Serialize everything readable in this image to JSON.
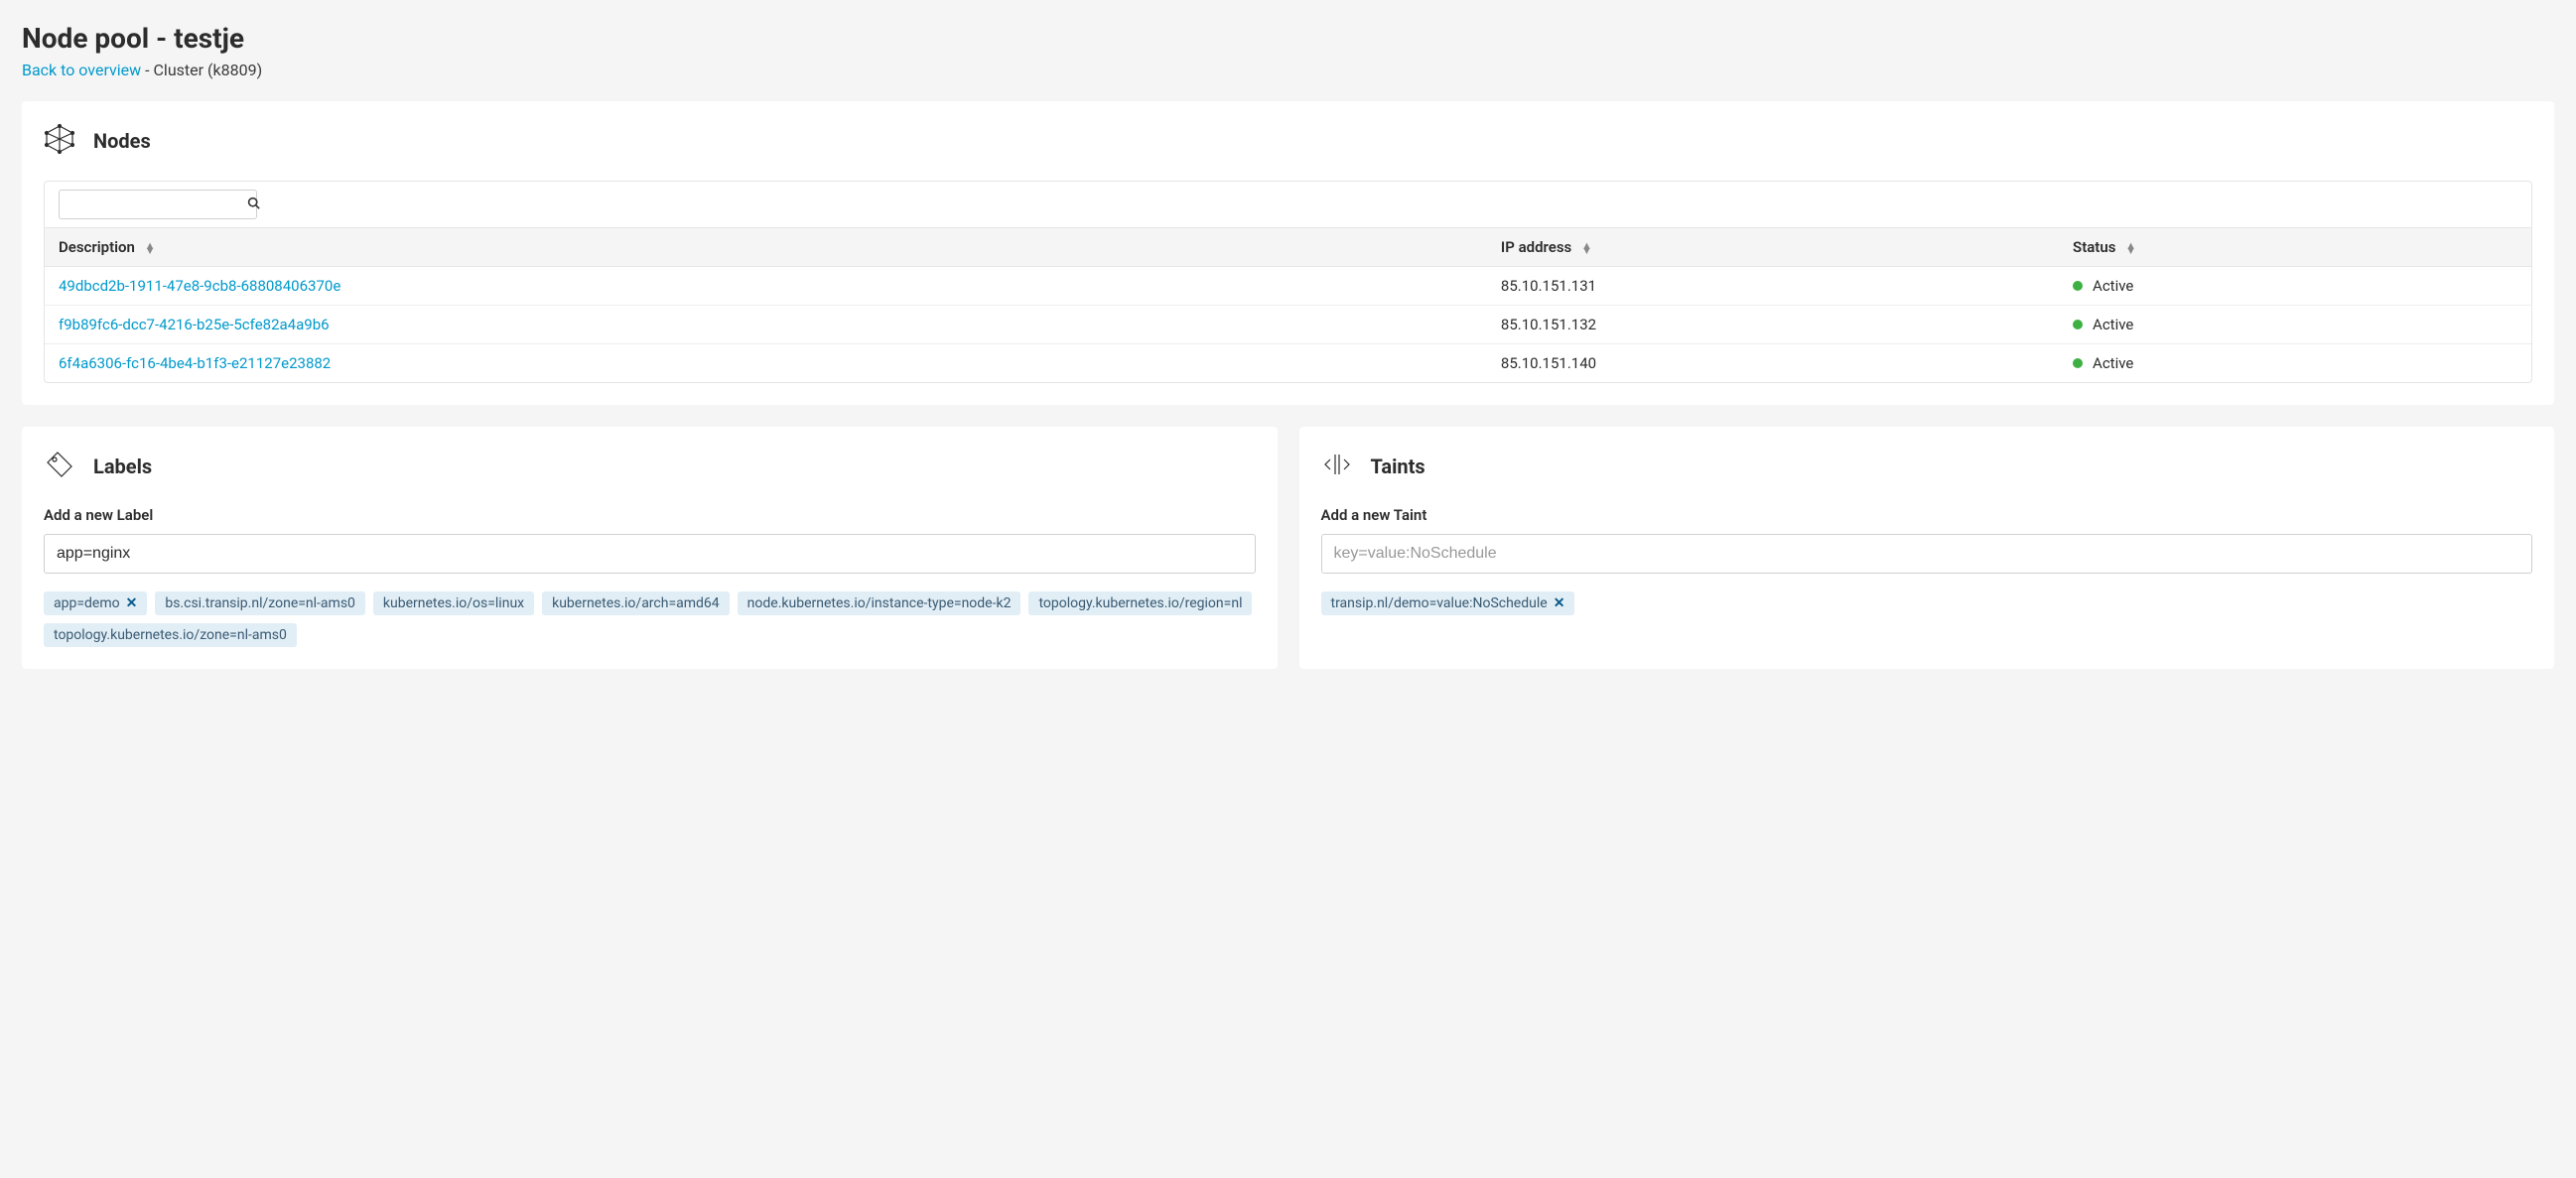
{
  "header": {
    "title": "Node pool - testje",
    "back_link": "Back to overview",
    "cluster_suffix": " - Cluster (k8809)"
  },
  "nodes_card": {
    "title": "Nodes",
    "search_value": "",
    "columns": {
      "description": "Description",
      "ip": "IP address",
      "status": "Status"
    },
    "rows": [
      {
        "description": "49dbcd2b-1911-47e8-9cb8-68808406370e",
        "ip": "85.10.151.131",
        "status": "Active"
      },
      {
        "description": "f9b89fc6-dcc7-4216-b25e-5cfe82a4a9b6",
        "ip": "85.10.151.132",
        "status": "Active"
      },
      {
        "description": "6f4a6306-fc16-4be4-b1f3-e21127e23882",
        "ip": "85.10.151.140",
        "status": "Active"
      }
    ]
  },
  "labels_card": {
    "title": "Labels",
    "field_label": "Add a new Label",
    "input_value": "app=nginx",
    "tags": [
      {
        "text": "app=demo",
        "removable": true
      },
      {
        "text": "bs.csi.transip.nl/zone=nl-ams0",
        "removable": false
      },
      {
        "text": "kubernetes.io/os=linux",
        "removable": false
      },
      {
        "text": "kubernetes.io/arch=amd64",
        "removable": false
      },
      {
        "text": "node.kubernetes.io/instance-type=node-k2",
        "removable": false
      },
      {
        "text": "topology.kubernetes.io/region=nl",
        "removable": false
      },
      {
        "text": "topology.kubernetes.io/zone=nl-ams0",
        "removable": false
      }
    ]
  },
  "taints_card": {
    "title": "Taints",
    "field_label": "Add a new Taint",
    "input_placeholder": "key=value:NoSchedule",
    "tags": [
      {
        "text": "transip.nl/demo=value:NoSchedule",
        "removable": true
      }
    ]
  }
}
